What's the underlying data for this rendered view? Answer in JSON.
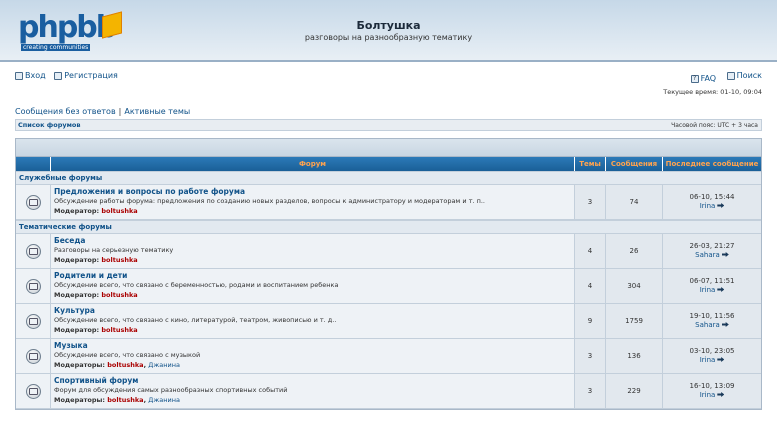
{
  "header": {
    "logo_text": "phpbb",
    "logo_sub": "creating communities",
    "title": "Болтушка",
    "description": "разговоры на разнообразную тематику"
  },
  "nav": {
    "login": "Вход",
    "register": "Регистрация",
    "faq": "FAQ",
    "search": "Поиск"
  },
  "time": "Текущее время: 01-10, 09:04",
  "links": {
    "unanswered": "Сообщения без ответов",
    "separator": "|",
    "active": "Активные темы"
  },
  "breadcrumb": {
    "index": "Список форумов",
    "timezone": "Часовой пояс: UTC + 3 часа"
  },
  "table": {
    "headers": {
      "forum": "Форум",
      "topics": "Темы",
      "posts": "Сообщения",
      "last": "Последнее сообщение"
    },
    "categories": [
      {
        "name": "Служебные форумы",
        "forums": [
          {
            "name": "Предложения и вопросы по работе форума",
            "desc": "Обсуждение работы форума: предложения по созданию новых разделов, вопросы к администратору и модераторам и т. п..",
            "mod_label": "Модератор:",
            "mods": [
              "boltushka"
            ],
            "topics": "3",
            "posts": "74",
            "last_date": "06-10, 15:44",
            "last_user": "Irina"
          }
        ]
      },
      {
        "name": "Тематические форумы",
        "forums": [
          {
            "name": "Беседа",
            "desc": "Разговоры на серьезную тематику",
            "mod_label": "Модератор:",
            "mods": [
              "boltushka"
            ],
            "topics": "4",
            "posts": "26",
            "last_date": "26-03, 21:27",
            "last_user": "Sahara"
          },
          {
            "name": "Родители и дети",
            "desc": "Обсуждение всего, что связано с беременностью, родами и воспитанием ребенка",
            "mod_label": "Модератор:",
            "mods": [
              "boltushka"
            ],
            "topics": "4",
            "posts": "304",
            "last_date": "06-07, 11:51",
            "last_user": "Irina"
          },
          {
            "name": "Культура",
            "desc": "Обсуждение всего, что связано с кино, литературой, театром, живописью и т. д..",
            "mod_label": "Модератор:",
            "mods": [
              "boltushka"
            ],
            "topics": "9",
            "posts": "1759",
            "last_date": "19-10, 11:56",
            "last_user": "Sahara"
          },
          {
            "name": "Музыка",
            "desc": "Обсуждение всего, что связано с музыкой",
            "mod_label": "Модераторы:",
            "mods": [
              "boltushka",
              "Джанина"
            ],
            "topics": "3",
            "posts": "136",
            "last_date": "03-10, 23:05",
            "last_user": "Irina"
          },
          {
            "name": "Спортивный форум",
            "desc": "Форум для обсуждения самых разнообразных спортивных событий",
            "mod_label": "Модераторы:",
            "mods": [
              "boltushka",
              "Джанина"
            ],
            "topics": "3",
            "posts": "229",
            "last_date": "16-10, 13:09",
            "last_user": "Irina"
          }
        ]
      }
    ]
  }
}
